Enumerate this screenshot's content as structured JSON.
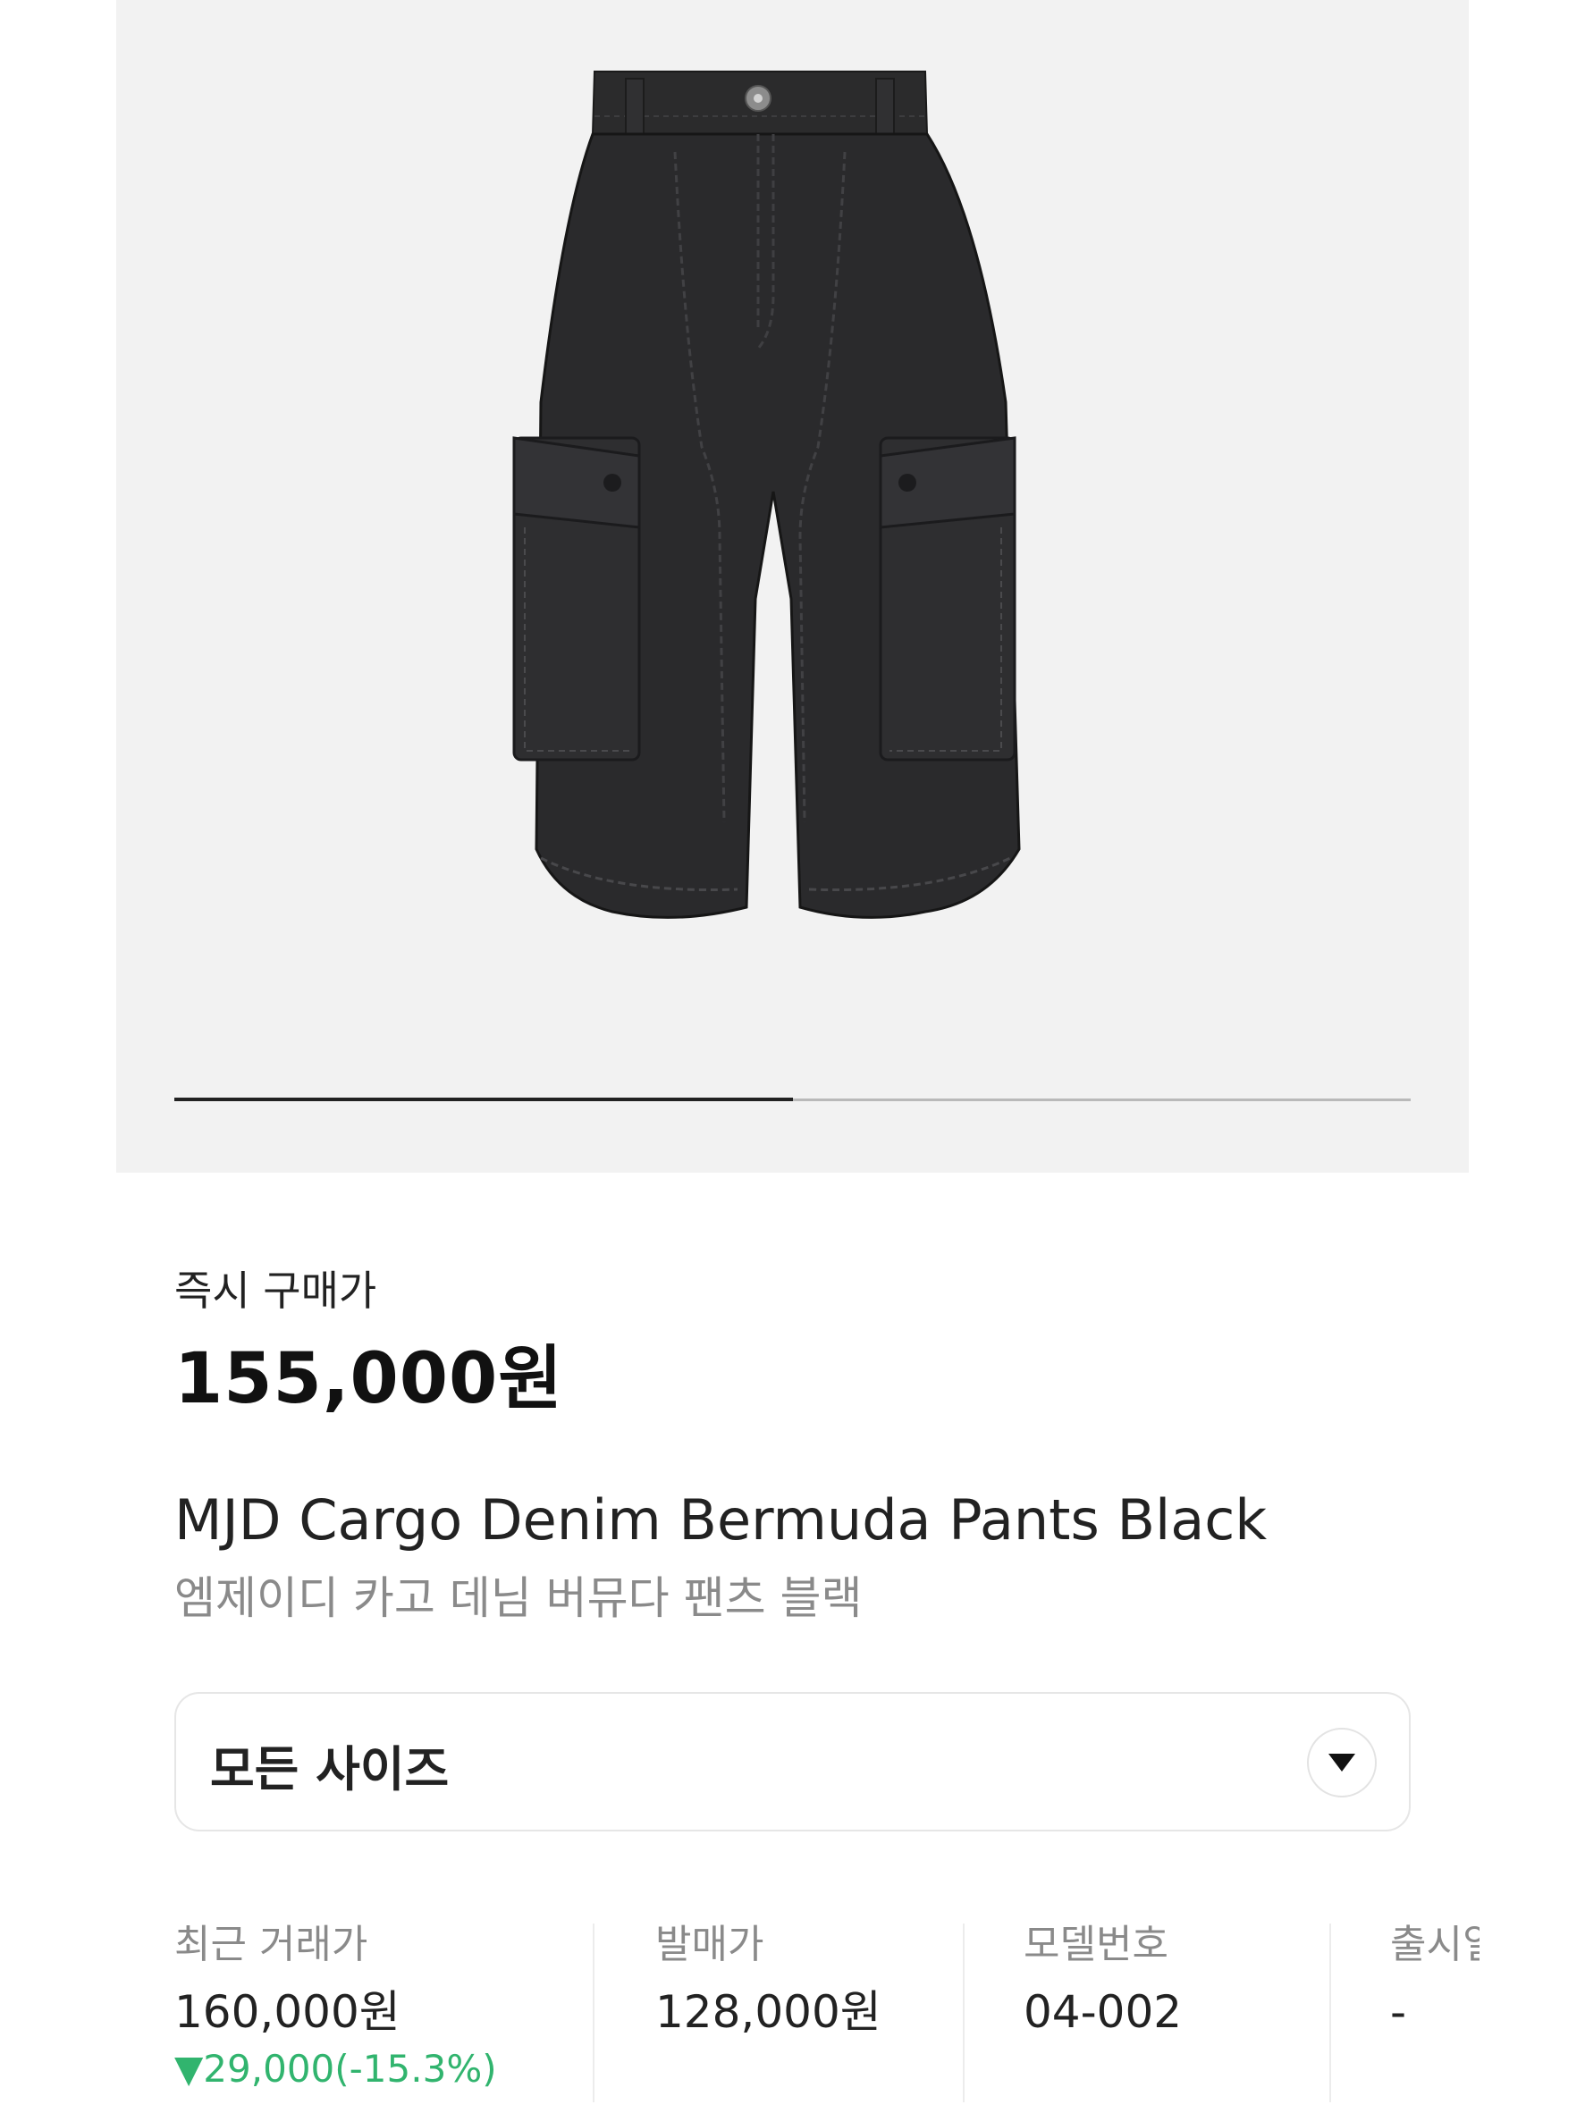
{
  "gallery": {
    "image": "black cargo denim bermuda shorts",
    "pager_progress": 0.5
  },
  "price": {
    "label": "즉시 구매가",
    "value": "155,000원"
  },
  "product": {
    "title": "MJD Cargo Denim Bermuda Pants Black",
    "subtitle": "엠제이디 카고 데님 버뮤다 팬츠 블랙"
  },
  "size_selector": {
    "value": "모든 사이즈",
    "icon": "chevron-down-icon"
  },
  "info": {
    "recent_trade": {
      "label": "최근 거래가",
      "value": "160,000원",
      "change": "▼29,000(-15.3%)"
    },
    "release_price": {
      "label": "발매가",
      "value": "128,000원"
    },
    "model_number": {
      "label": "모델번호",
      "value": "04-002"
    },
    "release_date": {
      "label": "출시일",
      "value": "-"
    }
  },
  "colors": {
    "gallery_bg": "#f2f2f2",
    "price_down": "#31b46e",
    "text_primary": "#222222",
    "text_secondary": "#8a8a8a"
  }
}
